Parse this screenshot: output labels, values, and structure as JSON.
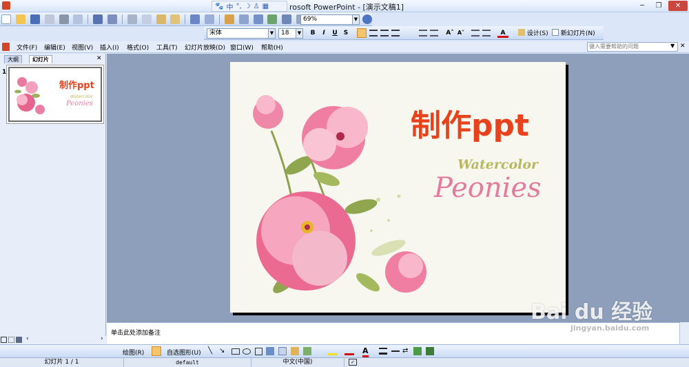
{
  "window": {
    "title": "rosoft PowerPoint - [演示文稿1]"
  },
  "ime": {
    "mode": "中"
  },
  "standard_toolbar": {
    "zoom": "69%"
  },
  "format_toolbar": {
    "font": "宋体",
    "font_size": "18",
    "bold": "B",
    "italic": "I",
    "underline": "U",
    "shadow": "S",
    "design_label": "设计(S)",
    "new_slide_label": "新幻灯片(N)"
  },
  "menu": {
    "items": [
      "文件(F)",
      "编辑(E)",
      "视图(V)",
      "插入(I)",
      "格式(O)",
      "工具(T)",
      "幻灯片放映(D)",
      "窗口(W)",
      "帮助(H)"
    ],
    "help_placeholder": "键入需要帮助的问题"
  },
  "left_pane": {
    "tabs": [
      "大纲",
      "幻灯片"
    ],
    "slide_number": "1",
    "thumb_title": "制作ppt",
    "thumb_sub1": "Watercolor",
    "thumb_sub2": "Peonies"
  },
  "slide": {
    "title": "制作ppt",
    "subtitle_1": "Watercolor",
    "subtitle_2": "Peonies"
  },
  "notes": {
    "placeholder": "单击此处添加备注"
  },
  "drawing_toolbar": {
    "draw_label": "绘图(R)",
    "autoshapes_label": "自选图形(U)"
  },
  "status": {
    "slide": "幻灯片 1 / 1",
    "design": "default",
    "language": "中文(中国)"
  },
  "watermark": {
    "brand": "Bai du 经验",
    "url": "jingyan.baidu.com"
  },
  "colors": {
    "accent": "#e8421c",
    "pink": "#e47a9e",
    "olive": "#b8b860"
  }
}
